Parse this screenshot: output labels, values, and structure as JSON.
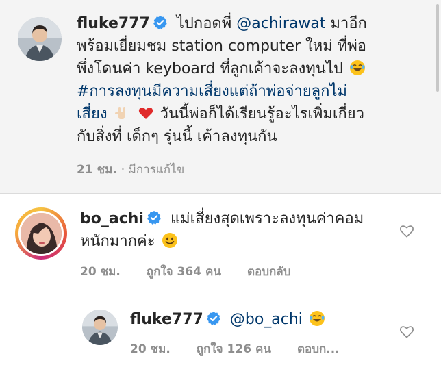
{
  "post": {
    "username": "fluke777",
    "verified": true,
    "caption_lead": "ไปกอดพี่",
    "mention": "@achirawat",
    "caption_line1_tail": "มาอีก",
    "caption_line2": "พร้อมเยี่ยมชม station computer ใหม่ ที่พ่อ",
    "caption_line3": "พึ่งโดนค่า keyboard ที่ลูกเค้าจะลงทุนไป",
    "hashtag_line1": "#การลงทุนมีความเสี่ยงแต่ถ้าพ่อจ่ายลูกไม่",
    "hashtag_line2": "เสี่ยง",
    "caption_tail1": "วันนี้พ่อก็ได้เรียนรู้อะไรเพิ่มเกี่ยว",
    "caption_tail2": "กับสิ่งที่ เด็กๆ รุ่นนี้ เค้าลงทุนกัน",
    "time": "21 ชม.",
    "edited": "· มีการแก้ไข",
    "emojis": [
      "laughing-tears",
      "love-you-hand",
      "red-heart"
    ]
  },
  "comments": [
    {
      "username": "bo_achi",
      "verified": true,
      "text_line1": "แม่เสี่ยงสุดเพราะลงทุนค่าคอม",
      "text_line2": "หนักมากค่ะ",
      "emoji": "smiling-face",
      "time": "20 ชม.",
      "likes": "ถูกใจ 364 คน",
      "reply": "ตอบกลับ"
    },
    {
      "username": "fluke777",
      "verified": true,
      "mention": "@bo_achi",
      "emoji": "laughing-tears",
      "time": "20 ชม.",
      "likes": "ถูกใจ 126 คน",
      "reply": "ตอบก..."
    }
  ],
  "colors": {
    "text": "#262626",
    "link": "#00376b",
    "meta": "#8e8e8e",
    "verified": "#3897f0",
    "header_bg": "#f4f4f4"
  }
}
